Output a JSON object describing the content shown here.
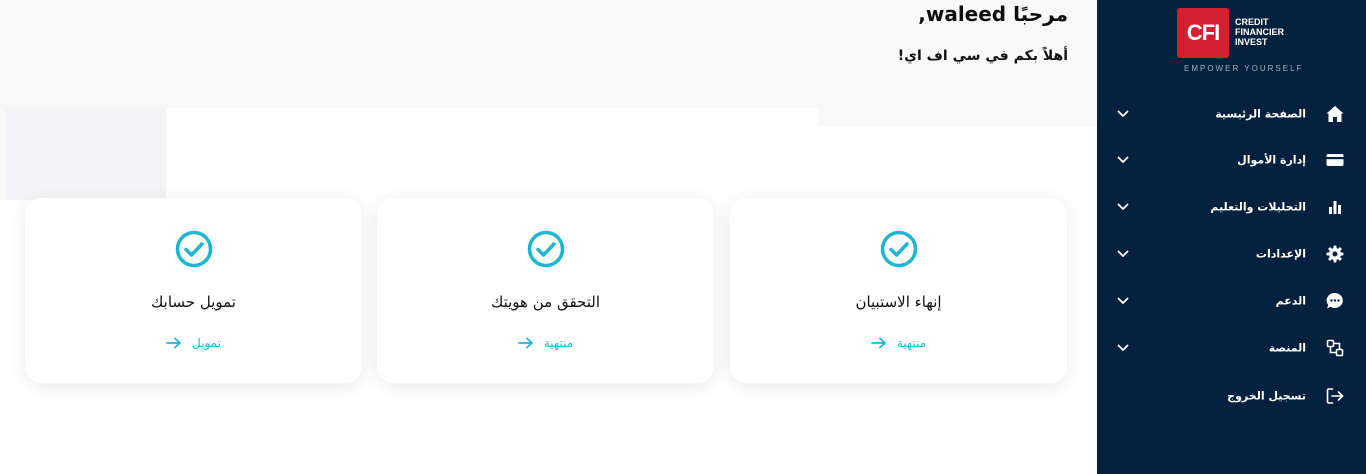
{
  "header": {
    "greeting": "مرحبًا waleed,",
    "subgreeting": "أهلاً بكم في سي اف اي!"
  },
  "cards": [
    {
      "title": "تمويل حسابك",
      "link": "تمويل",
      "icon": "check-circle-icon"
    },
    {
      "title": "التحقق من هويتك",
      "link": "منتهية",
      "icon": "check-circle-icon"
    },
    {
      "title": "إنهاء الاستبيان",
      "link": "منتهية",
      "icon": "check-circle-icon"
    }
  ],
  "brand": {
    "logo_mark": "CFI",
    "name_line1": "CREDIT",
    "name_line2": "FINANCIER",
    "name_line3": "INVEST",
    "tagline": "EMPOWER YOURSELF"
  },
  "sidebar": {
    "items": [
      {
        "label": "الصفحة الرئيسية",
        "icon": "home-icon",
        "expandable": true
      },
      {
        "label": "إدارة الأموال",
        "icon": "credit-card-icon",
        "expandable": true
      },
      {
        "label": "التحليلات والتعليم",
        "icon": "bar-chart-icon",
        "expandable": true
      },
      {
        "label": "الإعدادات",
        "icon": "gear-icon",
        "expandable": true
      },
      {
        "label": "الدعم",
        "icon": "chat-bubble-icon",
        "expandable": true
      },
      {
        "label": "المنصة",
        "icon": "platform-icon",
        "expandable": true
      },
      {
        "label": "تسجيل الخروج",
        "icon": "logout-icon",
        "expandable": false
      }
    ]
  },
  "colors": {
    "sidebar_bg": "#06213d",
    "accent_cyan": "#1bb6d0",
    "logo_red": "#d31f2f",
    "top_band": "#f8f8f9"
  }
}
